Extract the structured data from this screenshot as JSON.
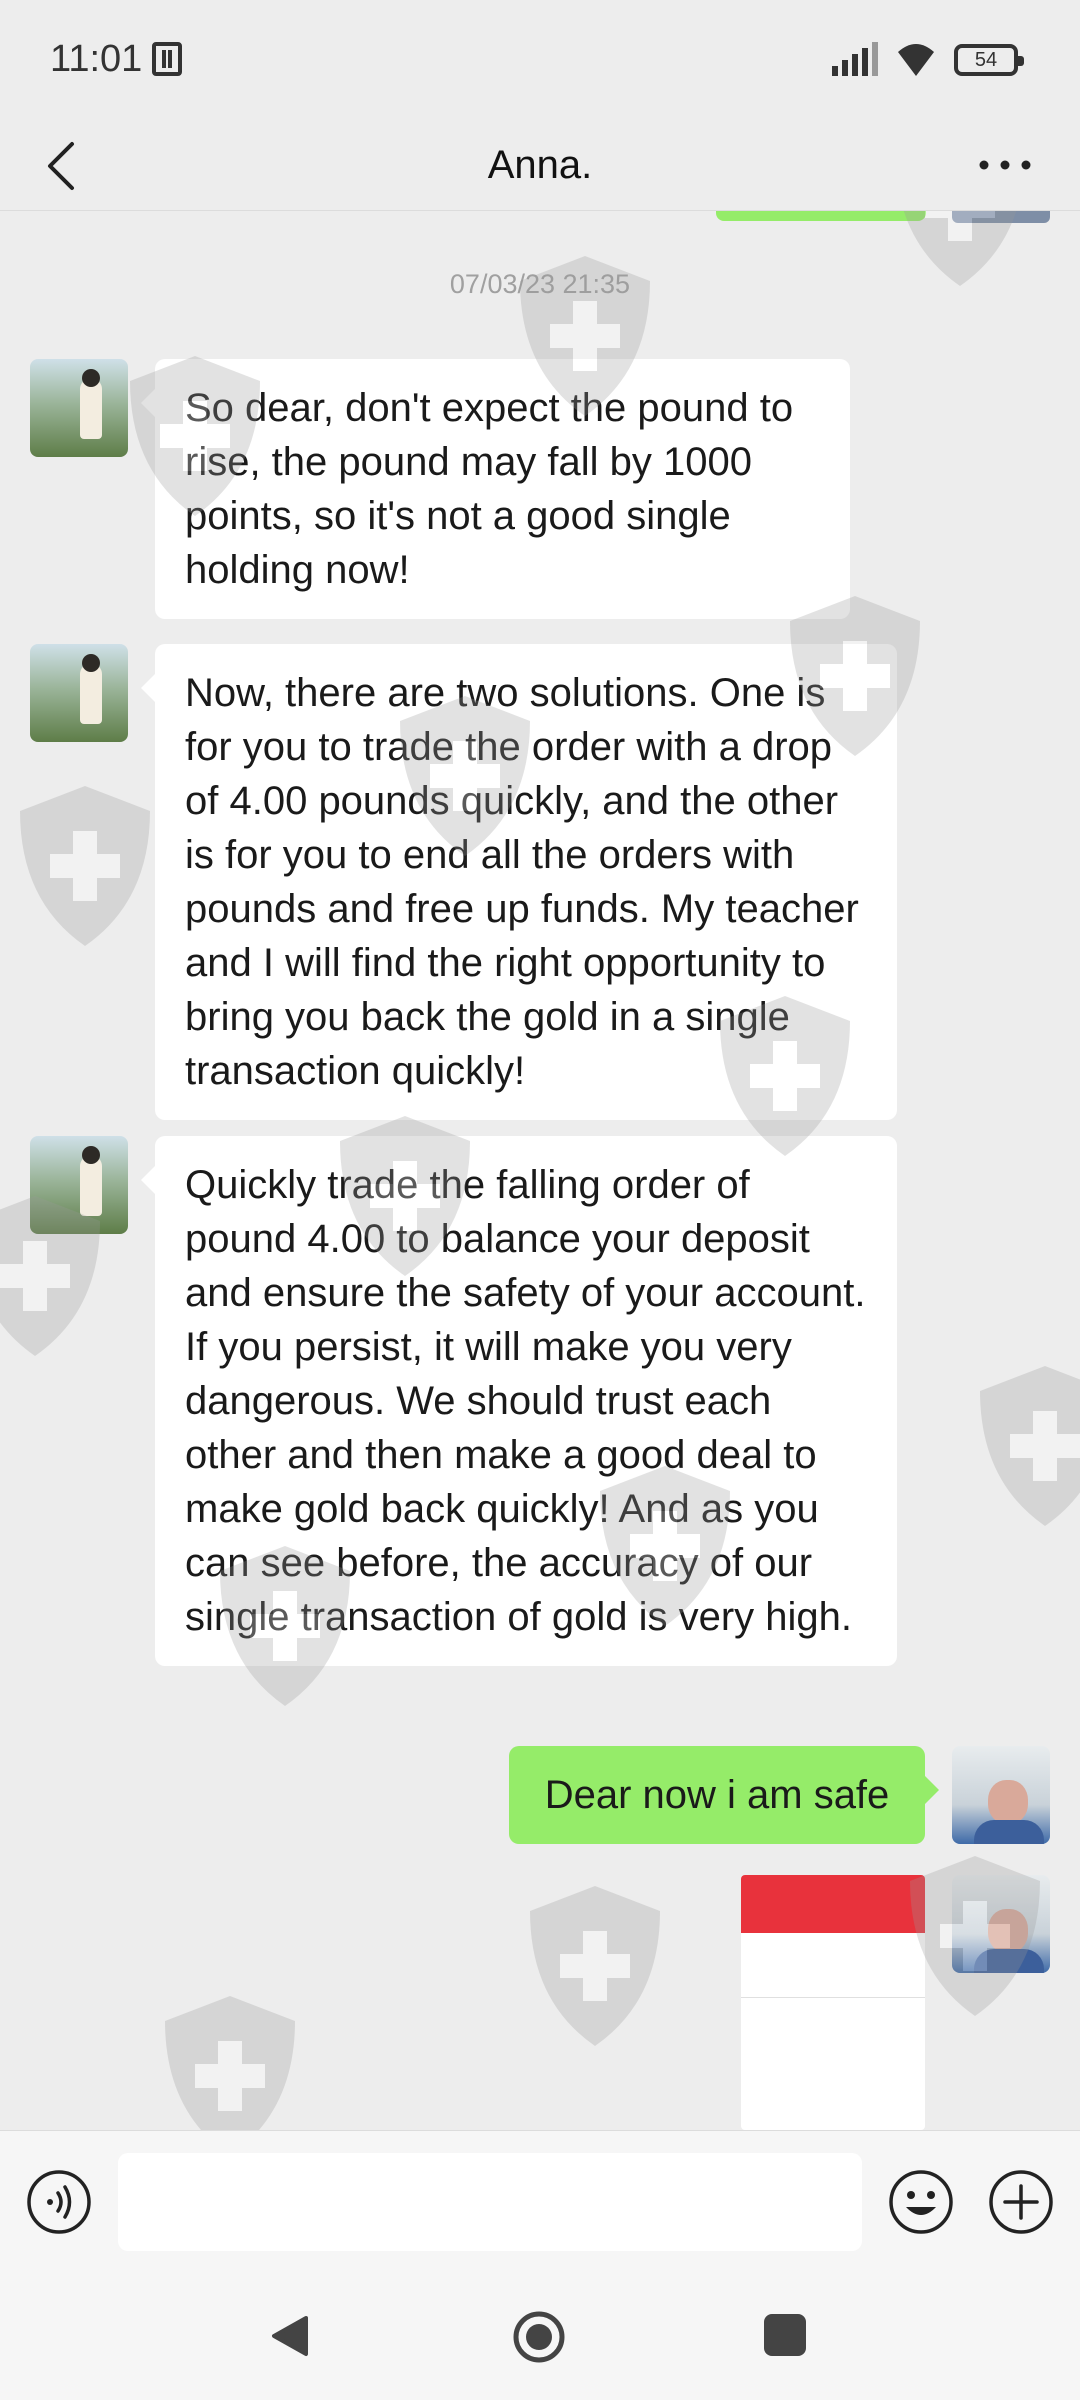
{
  "status_bar": {
    "time": "11:01",
    "battery": "54",
    "icons": [
      "nfc-icon",
      "signal-icon",
      "wifi-icon",
      "battery-icon"
    ]
  },
  "header": {
    "title": "Anna.",
    "back_icon": "chevron-left-icon",
    "more_icon": "more-horizontal-icon"
  },
  "chat": {
    "timestamp": "07/03/23 21:35",
    "messages": [
      {
        "sender": "Anna.",
        "side": "left",
        "text": "So dear, don't expect the pound to rise, the pound may fall by 1000 points, so it's not a good single holding now!"
      },
      {
        "sender": "Anna.",
        "side": "left",
        "text": "Now, there are two solutions. One is for you to trade the order with a drop of 4.00 pounds quickly, and the other is for you to end all the orders with pounds and free up funds. My teacher and I will find the right opportunity to bring you back the gold in a single transaction quickly!"
      },
      {
        "sender": "Anna.",
        "side": "left",
        "text": "Quickly trade the falling order of pound 4.00 to balance your deposit and ensure the safety of your account. If you persist, it will make you very dangerous. We should trust each other and then make a good deal to make gold back quickly! And as you can see before, the accuracy of our single transaction of gold is very high."
      },
      {
        "sender": "me",
        "side": "right",
        "text": "Dear now i am safe"
      },
      {
        "sender": "me",
        "side": "right",
        "type": "image",
        "image_desc": "trading-app-screenshot"
      }
    ]
  },
  "input_bar": {
    "value": "",
    "placeholder": "",
    "icons": [
      "voice-icon",
      "emoji-icon",
      "plus-icon"
    ]
  },
  "nav_bar": {
    "icons": [
      "nav-back-icon",
      "nav-home-icon",
      "nav-recent-icon"
    ]
  },
  "colors": {
    "background": "#ededed",
    "incoming_bubble": "#ffffff",
    "outgoing_bubble": "#95ec69",
    "text": "#1a1a1a",
    "timestamp": "#a0a0a0",
    "screenshot_header": "#e8323c"
  }
}
